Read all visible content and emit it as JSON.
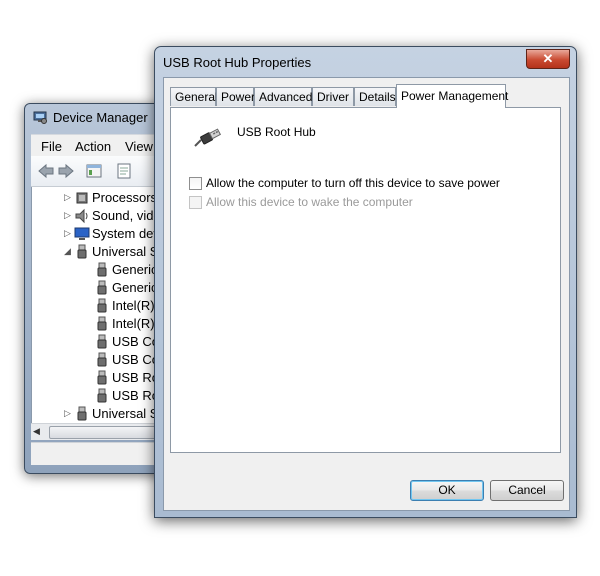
{
  "device_manager": {
    "title": "Device Manager",
    "menu": [
      "File",
      "Action",
      "View"
    ],
    "tree": [
      {
        "label": "Processors",
        "expanded": false,
        "icon": "processor-icon",
        "level": 0
      },
      {
        "label": "Sound, vide",
        "expanded": false,
        "icon": "speaker-icon",
        "level": 0
      },
      {
        "label": "System dev",
        "expanded": false,
        "icon": "computer-icon",
        "level": 0
      },
      {
        "label": "Universal Se",
        "expanded": true,
        "icon": "usb-icon",
        "level": 0
      },
      {
        "label": "Generic",
        "icon": "usb-icon",
        "level": 1
      },
      {
        "label": "Generic",
        "icon": "usb-icon",
        "level": 1
      },
      {
        "label": "Intel(R)",
        "icon": "usb-icon",
        "level": 1
      },
      {
        "label": "Intel(R)",
        "icon": "usb-icon",
        "level": 1
      },
      {
        "label": "USB Co",
        "icon": "usb-icon",
        "level": 1
      },
      {
        "label": "USB Co",
        "icon": "usb-icon",
        "level": 1
      },
      {
        "label": "USB Ro",
        "icon": "usb-icon",
        "level": 1
      },
      {
        "label": "USB Ro",
        "icon": "usb-icon",
        "level": 1
      },
      {
        "label": "Universal Se",
        "expanded": false,
        "icon": "usb-icon",
        "level": 0
      }
    ]
  },
  "properties": {
    "title": "USB Root Hub Properties",
    "close_label": "✕",
    "tabs": [
      "General",
      "Power",
      "Advanced",
      "Driver",
      "Details",
      "Power Management"
    ],
    "active_tab": "Power Management",
    "device_name": "USB Root Hub",
    "options": [
      {
        "label": "Allow the computer to turn off this device to save power",
        "checked": false,
        "enabled": true
      },
      {
        "label": "Allow this device to wake the computer",
        "checked": false,
        "enabled": false
      }
    ],
    "ok_label": "OK",
    "cancel_label": "Cancel"
  },
  "colors": {
    "titlebar": "#b9c7d9",
    "close_button": "#c94a31",
    "default_button_border": "#3c7fb1",
    "disabled_text": "#9a9a9a"
  }
}
